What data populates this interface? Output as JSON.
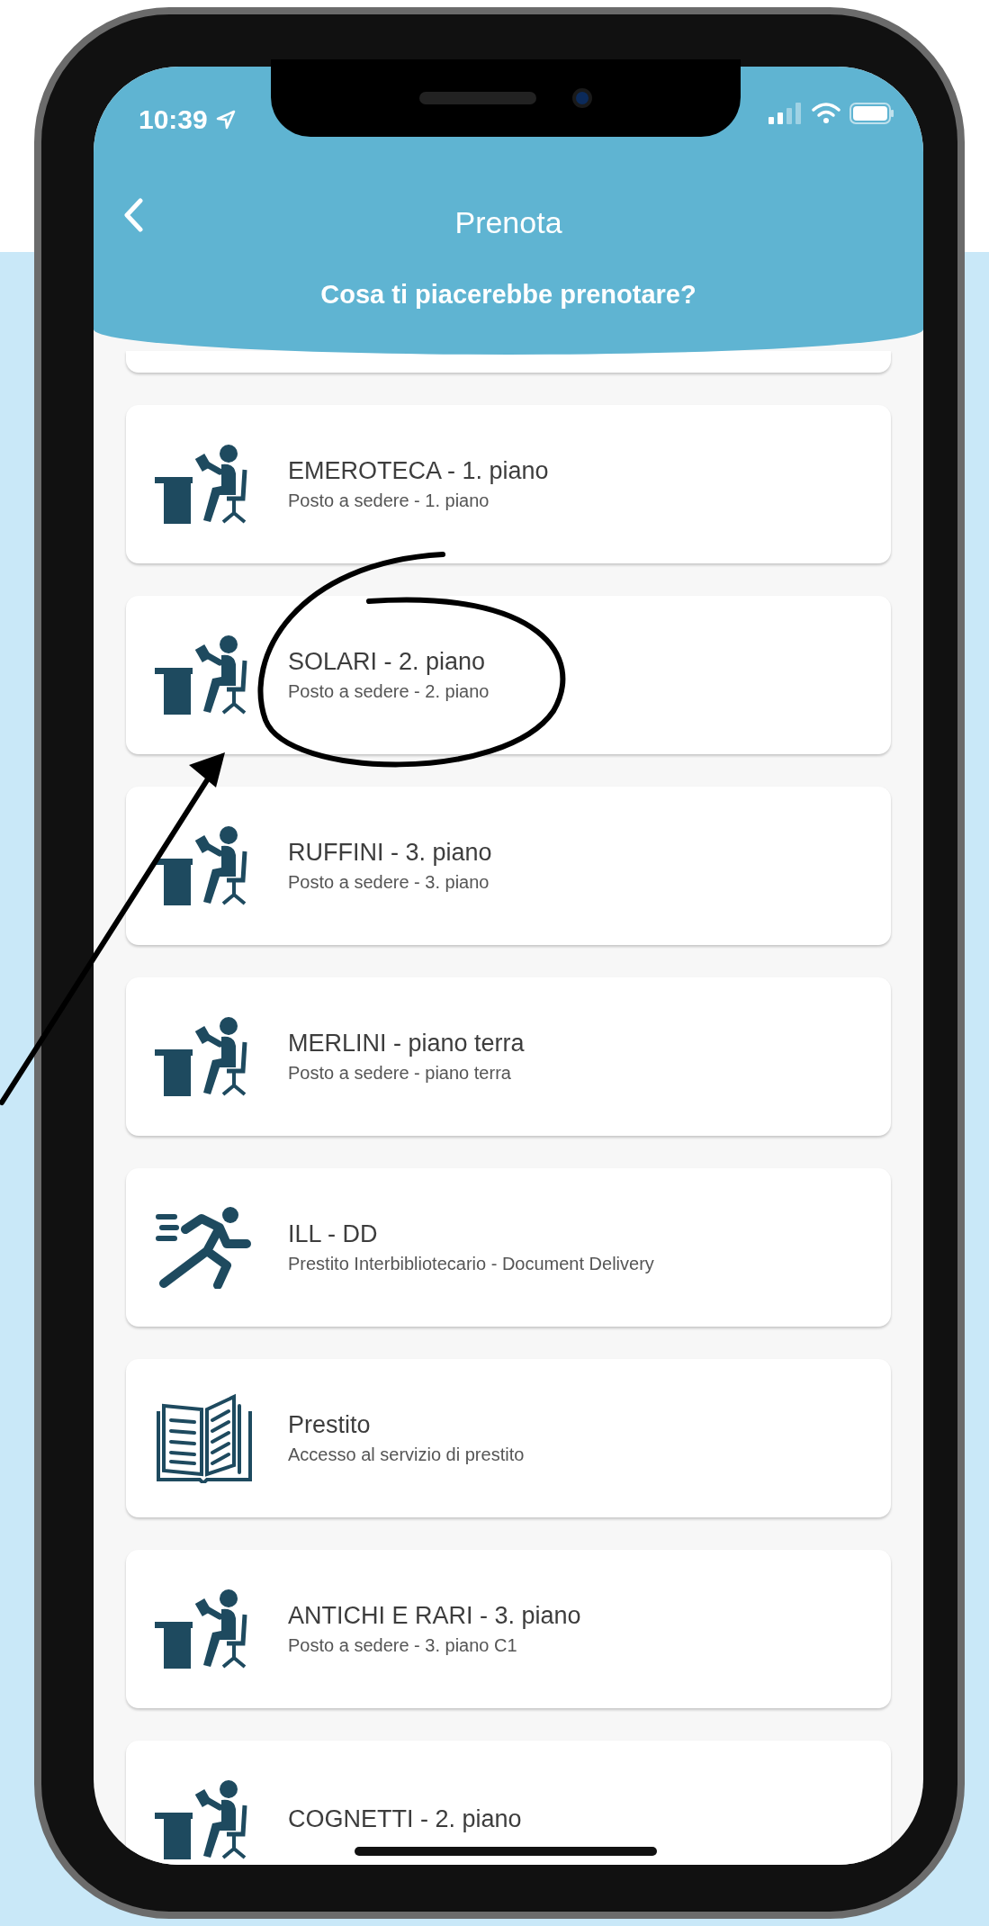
{
  "status_bar": {
    "time": "10:39"
  },
  "header": {
    "title": "Prenota",
    "subtitle": "Cosa ti piacerebbe prenotare?"
  },
  "items": [
    {
      "kind": "desk",
      "title": "EMEROTECA - 1. piano",
      "subtitle": "Posto a sedere - 1. piano"
    },
    {
      "kind": "desk",
      "title": "SOLARI - 2. piano",
      "subtitle": "Posto a sedere - 2. piano"
    },
    {
      "kind": "desk",
      "title": "RUFFINI - 3. piano",
      "subtitle": "Posto a sedere - 3. piano"
    },
    {
      "kind": "desk",
      "title": "MERLINI - piano terra",
      "subtitle": "Posto a sedere - piano terra"
    },
    {
      "kind": "runner",
      "title": "ILL - DD",
      "subtitle": "Prestito Interbibliotecario - Document Delivery"
    },
    {
      "kind": "book",
      "title": "Prestito",
      "subtitle": "Accesso al servizio di prestito"
    },
    {
      "kind": "desk",
      "title": "ANTICHI E RARI - 3. piano",
      "subtitle": "Posto a sedere - 3. piano C1"
    },
    {
      "kind": "desk",
      "title": "COGNETTI - 2. piano"
    }
  ]
}
